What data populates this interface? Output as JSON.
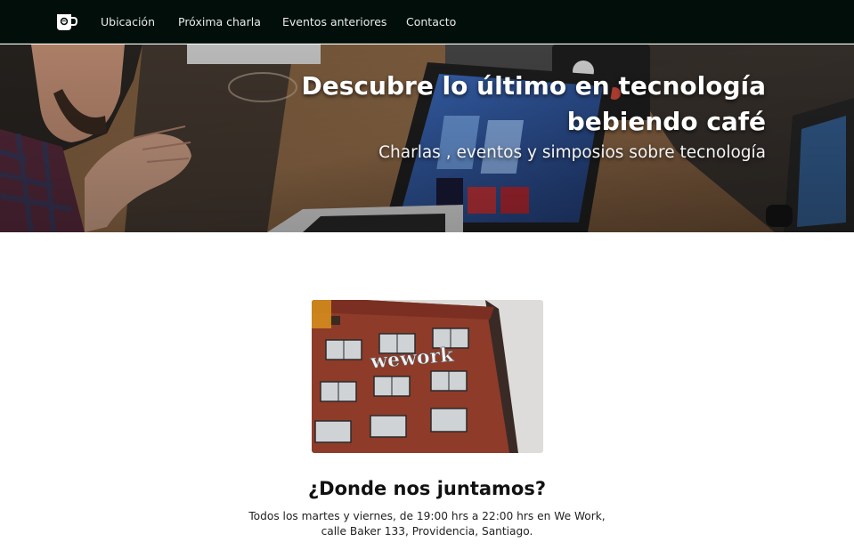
{
  "navbar": {
    "logo_icon": "coffee-mug-icon",
    "links": [
      {
        "label": "Ubicación"
      },
      {
        "label": "Próxima charla"
      },
      {
        "label": "Eventos anteriores"
      },
      {
        "label": "Contacto"
      }
    ]
  },
  "hero": {
    "title_line1": "Descubre lo último en tecnología",
    "title_line2": "bebiendo café",
    "subtitle": "Charlas , eventos y simposios sobre tecnología"
  },
  "location": {
    "sign_text": "wework",
    "heading": "¿Donde nos juntamos?",
    "line1": "Todos los martes y viernes, de 19:00 hrs a 22:00 hrs en We Work,",
    "line2": "calle Baker 133, Providencia, Santiago."
  },
  "colors": {
    "navbar_bg": "#020e09",
    "nav_text": "#e8ecea",
    "page_bg": "#ffffff",
    "heading_text": "#111111"
  }
}
